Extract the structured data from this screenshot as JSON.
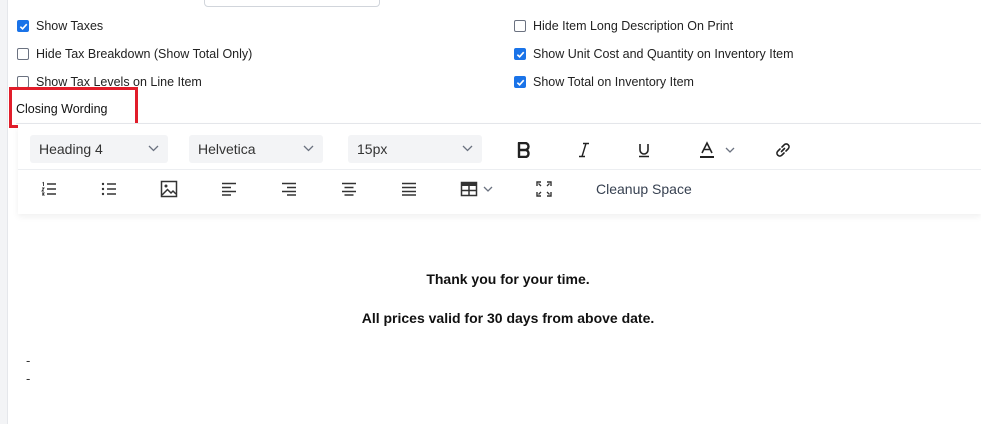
{
  "options": {
    "show_taxes": {
      "label": "Show Taxes",
      "checked": true
    },
    "hide_tax_breakdown": {
      "label": "Hide Tax Breakdown (Show Total Only)",
      "checked": false
    },
    "show_tax_levels": {
      "label": "Show Tax Levels on Line Item",
      "checked": false
    },
    "hide_item_long_desc": {
      "label": "Hide Item Long Description On Print",
      "checked": false
    },
    "show_unit_cost_qty": {
      "label": "Show Unit Cost and Quantity on Inventory Item",
      "checked": true
    },
    "show_total_inventory": {
      "label": "Show Total on Inventory Item",
      "checked": true
    }
  },
  "section": {
    "label": "Closing Wording"
  },
  "toolbar": {
    "block_format": "Heading 4",
    "font_family": "Helvetica",
    "font_size": "15px",
    "cleanup_label": "Cleanup Space"
  },
  "content": {
    "line1": "Thank you for your time.",
    "line2": "All prices valid for 30 days from above date.",
    "dash1": "-",
    "dash2": "-"
  },
  "colors": {
    "accent": "#1a73e8",
    "highlight": "#e11d2a"
  }
}
